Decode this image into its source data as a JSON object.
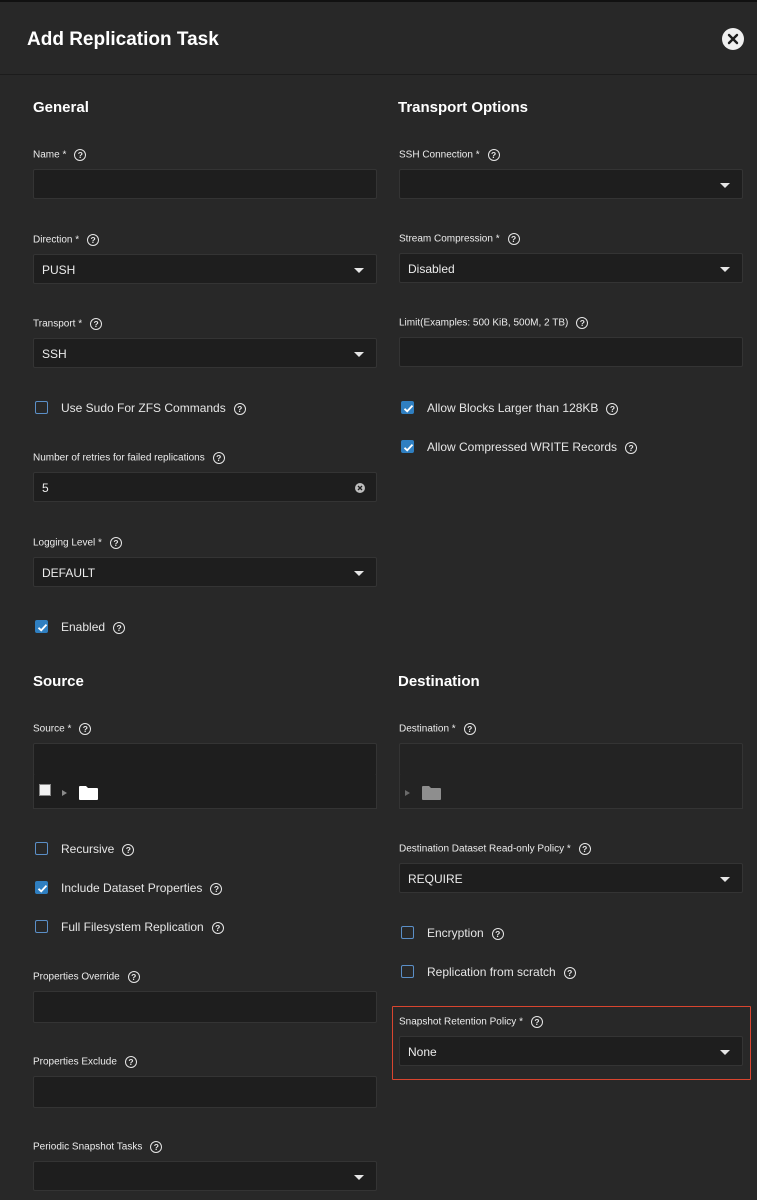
{
  "header": {
    "title": "Add Replication Task"
  },
  "general": {
    "heading": "General",
    "name": {
      "label": "Name *",
      "value": ""
    },
    "direction": {
      "label": "Direction *",
      "value": "PUSH"
    },
    "transport": {
      "label": "Transport *",
      "value": "SSH"
    },
    "use_sudo": {
      "label": "Use Sudo For ZFS Commands",
      "checked": false
    },
    "retries": {
      "label": "Number of retries for failed replications",
      "value": "5"
    },
    "logging": {
      "label": "Logging Level *",
      "value": "DEFAULT"
    },
    "enabled": {
      "label": "Enabled",
      "checked": true
    }
  },
  "transport_options": {
    "heading": "Transport Options",
    "ssh_connection": {
      "label": "SSH Connection *",
      "value": ""
    },
    "stream_compression": {
      "label": "Stream Compression *",
      "value": "Disabled"
    },
    "limit": {
      "label": "Limit(Examples: 500 KiB, 500M, 2 TB)",
      "value": ""
    },
    "large_blocks": {
      "label": "Allow Blocks Larger than 128KB",
      "checked": true
    },
    "compressed_write": {
      "label": "Allow Compressed WRITE Records",
      "checked": true
    }
  },
  "source": {
    "heading": "Source",
    "source": {
      "label": "Source *",
      "value": ""
    },
    "recursive": {
      "label": "Recursive",
      "checked": false
    },
    "include_props": {
      "label": "Include Dataset Properties",
      "checked": true
    },
    "full_fs": {
      "label": "Full Filesystem Replication",
      "checked": false
    },
    "props_override": {
      "label": "Properties Override",
      "value": ""
    },
    "props_exclude": {
      "label": "Properties Exclude",
      "value": ""
    },
    "periodic_tasks": {
      "label": "Periodic Snapshot Tasks",
      "value": ""
    }
  },
  "destination": {
    "heading": "Destination",
    "destination": {
      "label": "Destination *",
      "value": ""
    },
    "readonly_policy": {
      "label": "Destination Dataset Read-only Policy *",
      "value": "REQUIRE"
    },
    "encryption": {
      "label": "Encryption",
      "checked": false
    },
    "from_scratch": {
      "label": "Replication from scratch",
      "checked": false
    },
    "retention": {
      "label": "Snapshot Retention Policy *",
      "value": "None"
    }
  },
  "help_glyph": "?",
  "colors": {
    "background": "#282828",
    "field": "#1e1e1e",
    "checkbox_on": "#2f7fc1",
    "highlight": "#d9452f"
  }
}
